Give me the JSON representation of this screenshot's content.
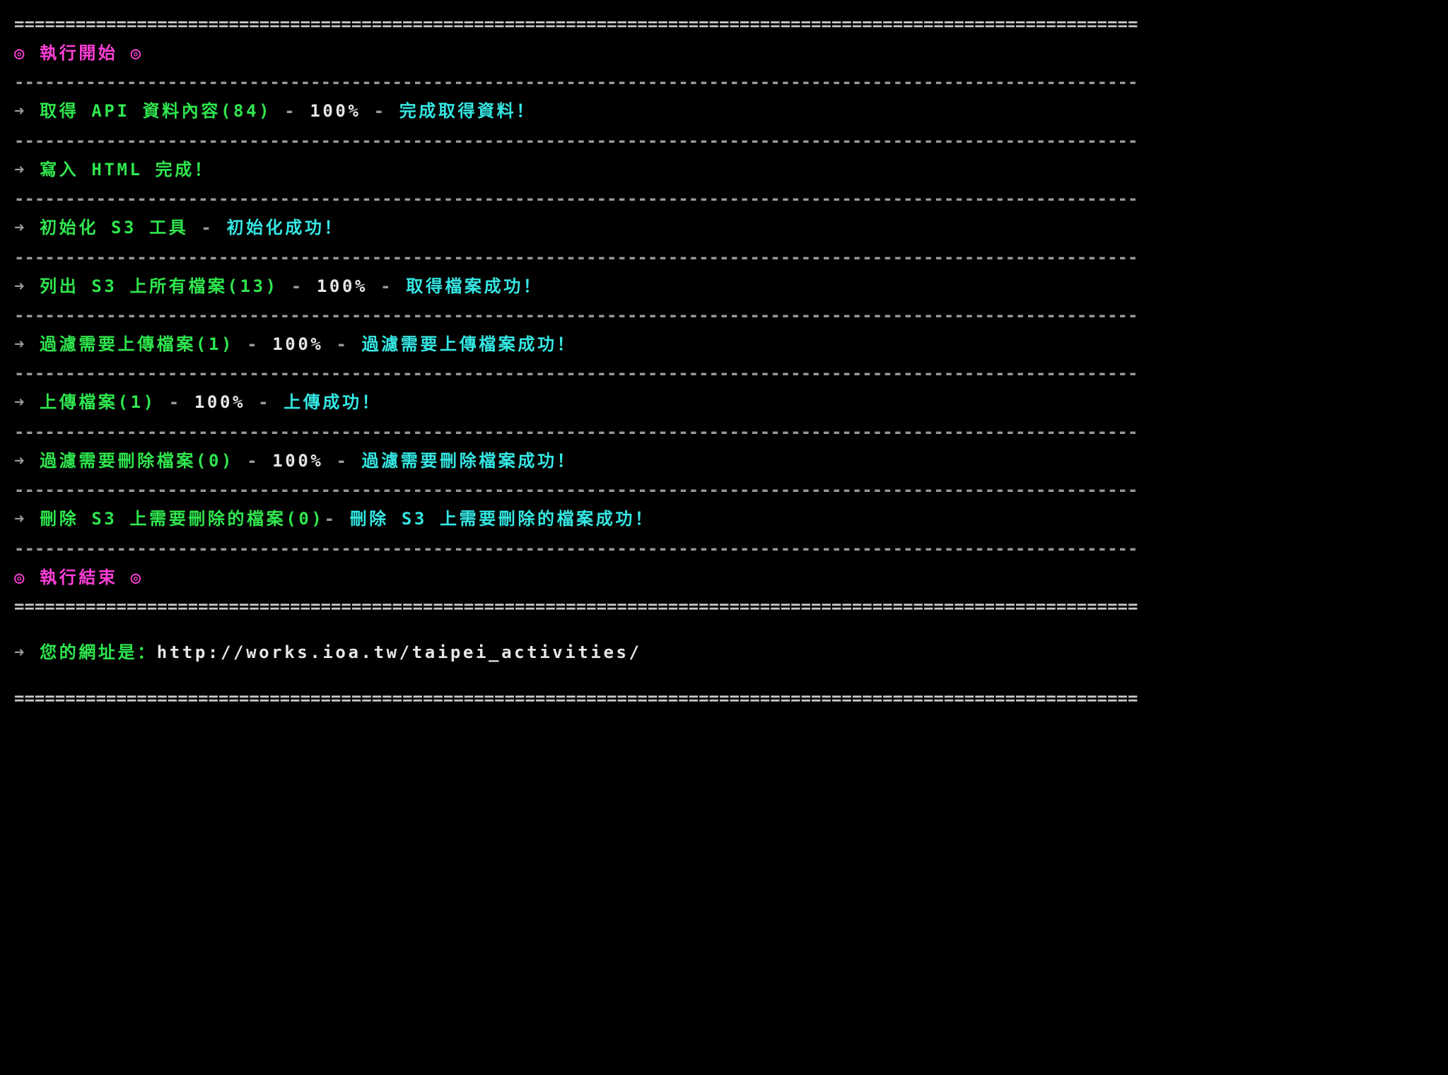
{
  "sep_double": "==============================================================================================================",
  "sep_dash": "--------------------------------------------------------------------------------------------------------------",
  "header": {
    "bullet_l": "◎",
    "title": "執行開始",
    "bullet_r": "◎"
  },
  "steps": [
    {
      "arrow": "➜",
      "task": "取得 API 資料內容(84)",
      "sep1": " - ",
      "pct": "100%",
      "sep2": " - ",
      "status": "完成取得資料！"
    },
    {
      "arrow": "➜",
      "task": "寫入 HTML 完成！",
      "sep1": "",
      "pct": "",
      "sep2": "",
      "status": ""
    },
    {
      "arrow": "➜",
      "task": "初始化 S3 工具",
      "sep1": " - ",
      "pct": "",
      "sep2": "",
      "status": "初始化成功！"
    },
    {
      "arrow": "➜",
      "task": "列出 S3 上所有檔案(13)",
      "sep1": " - ",
      "pct": "100%",
      "sep2": " - ",
      "status": "取得檔案成功！"
    },
    {
      "arrow": "➜",
      "task": "過濾需要上傳檔案(1)",
      "sep1": " - ",
      "pct": "100%",
      "sep2": " - ",
      "status": "過濾需要上傳檔案成功！"
    },
    {
      "arrow": "➜",
      "task": "上傳檔案(1)",
      "sep1": " - ",
      "pct": "100%",
      "sep2": " - ",
      "status": "上傳成功！"
    },
    {
      "arrow": "➜",
      "task": "過濾需要刪除檔案(0)",
      "sep1": " - ",
      "pct": "100%",
      "sep2": " - ",
      "status": "過濾需要刪除檔案成功！"
    },
    {
      "arrow": "➜",
      "task": "刪除 S3 上需要刪除的檔案(0)",
      "sep1": "- ",
      "pct": "",
      "sep2": "",
      "status": "刪除 S3 上需要刪除的檔案成功！"
    }
  ],
  "footer": {
    "bullet_l": "◎",
    "title": "執行結束",
    "bullet_r": "◎"
  },
  "url_line": {
    "arrow": "➜",
    "label": "您的網址是：",
    "url": "http://works.ioa.tw/taipei_activities/"
  }
}
